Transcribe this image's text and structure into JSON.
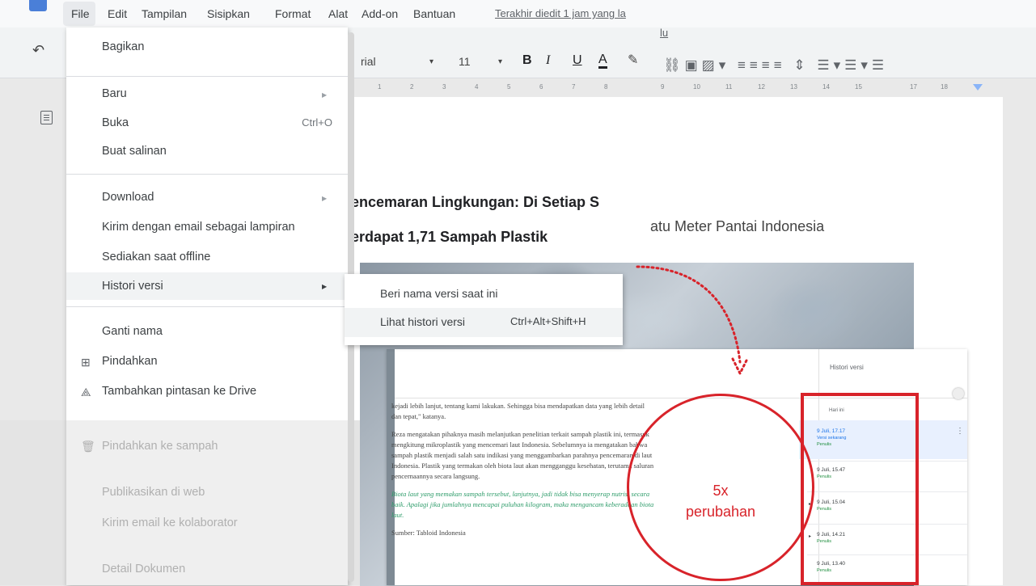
{
  "menubar": {
    "items": [
      "File",
      "Edit",
      "Tampilan",
      "Sisipkan",
      "Format",
      "Alat",
      "Add-on",
      "Bantuan"
    ],
    "last_edit": "Terakhir diedit 1 jam yang la",
    "last_edit_tail": "lu"
  },
  "toolbar": {
    "font": "rial",
    "font_size": "11",
    "bold": "B",
    "italic": "I",
    "underline": "U",
    "text_color": "A"
  },
  "ruler": [
    "1",
    "2",
    "3",
    "4",
    "5",
    "6",
    "7",
    "8",
    "9",
    "10",
    "11",
    "12",
    "13",
    "14",
    "15",
    "17",
    "18"
  ],
  "document": {
    "title_line1": "encemaran Lingkungan: Di Setiap S",
    "title_line2": "erdapat 1,71 Sampah Plastik",
    "title_right": "atu Meter Pantai Indonesia"
  },
  "file_menu": {
    "share": "Bagikan",
    "new": "Baru",
    "open": "Buka",
    "open_shortcut": "Ctrl+O",
    "make_copy": "Buat salinan",
    "download": "Download",
    "email_attachment": "Kirim dengan email sebagai lampiran",
    "offline": "Sediakan saat offline",
    "version_history": "Histori versi",
    "rename": "Ganti nama",
    "move": "Pindahkan",
    "add_shortcut": "Tambahkan pintasan ke Drive",
    "move_to_trash": "Pindahkan ke sampah",
    "publish": "Publikasikan di web",
    "email_collaborators": "Kirim email ke kolaborator",
    "details": "Detail Dokumen"
  },
  "submenu": {
    "name_version": "Beri nama versi saat ini",
    "see_history": "Lihat histori versi",
    "see_history_shortcut": "Ctrl+Alt+Shift+H"
  },
  "inset": {
    "panel_title": "Histori versi",
    "para1": "kejadi lebih lanjut, tentang kami lakukan. Sehingga bisa mendapatkan data yang lebih detail dan tepat,\" katanya.",
    "para2": "Reza mengatakan pihaknya masih melanjutkan penelitian terkait sampah plastik ini, termasuk mengkitung mikroplastik yang mencemari laut Indonesia. Sebelumnya ia mengatakan bahwa sampah plastik menjadi salah satu indikasi yang menggambarkan parahnya pencemaran di laut Indonesia. Plastik yang termakan oleh biota laut akan mengganggu kesehatan, terutama saluran pencernaannya secara langsung.",
    "para3": "Biota laut yang memakan sampah tersebut, lanjutnya, jadi tidak bisa menyerap nutrisi secara baik. Apalagi jika jumlahnya mencapai puluhan kilogram, maka mengancam keberadaan biota laut.",
    "para4": "Sumber: Tabloid Indonesia",
    "entries": [
      {
        "date": "9 Juli, 17.17",
        "status": "Versi sekarang",
        "by": "Penulis"
      },
      {
        "date": "9 Juli, 15.47",
        "status": "",
        "by": "Penulis"
      },
      {
        "date": "9 Juli, 15.04",
        "status": "",
        "by": "Penulis"
      },
      {
        "date": "9 Juli, 14.21",
        "status": "",
        "by": "Penulis"
      },
      {
        "date": "9 Juli, 13.40",
        "status": "",
        "by": "Penulis"
      }
    ],
    "group_label": "Hari ini"
  },
  "annotation": {
    "line1": "5x",
    "line2": "perubahan"
  },
  "colors": {
    "accent_red": "#d8232a",
    "docs_blue": "#4a7fd8"
  }
}
